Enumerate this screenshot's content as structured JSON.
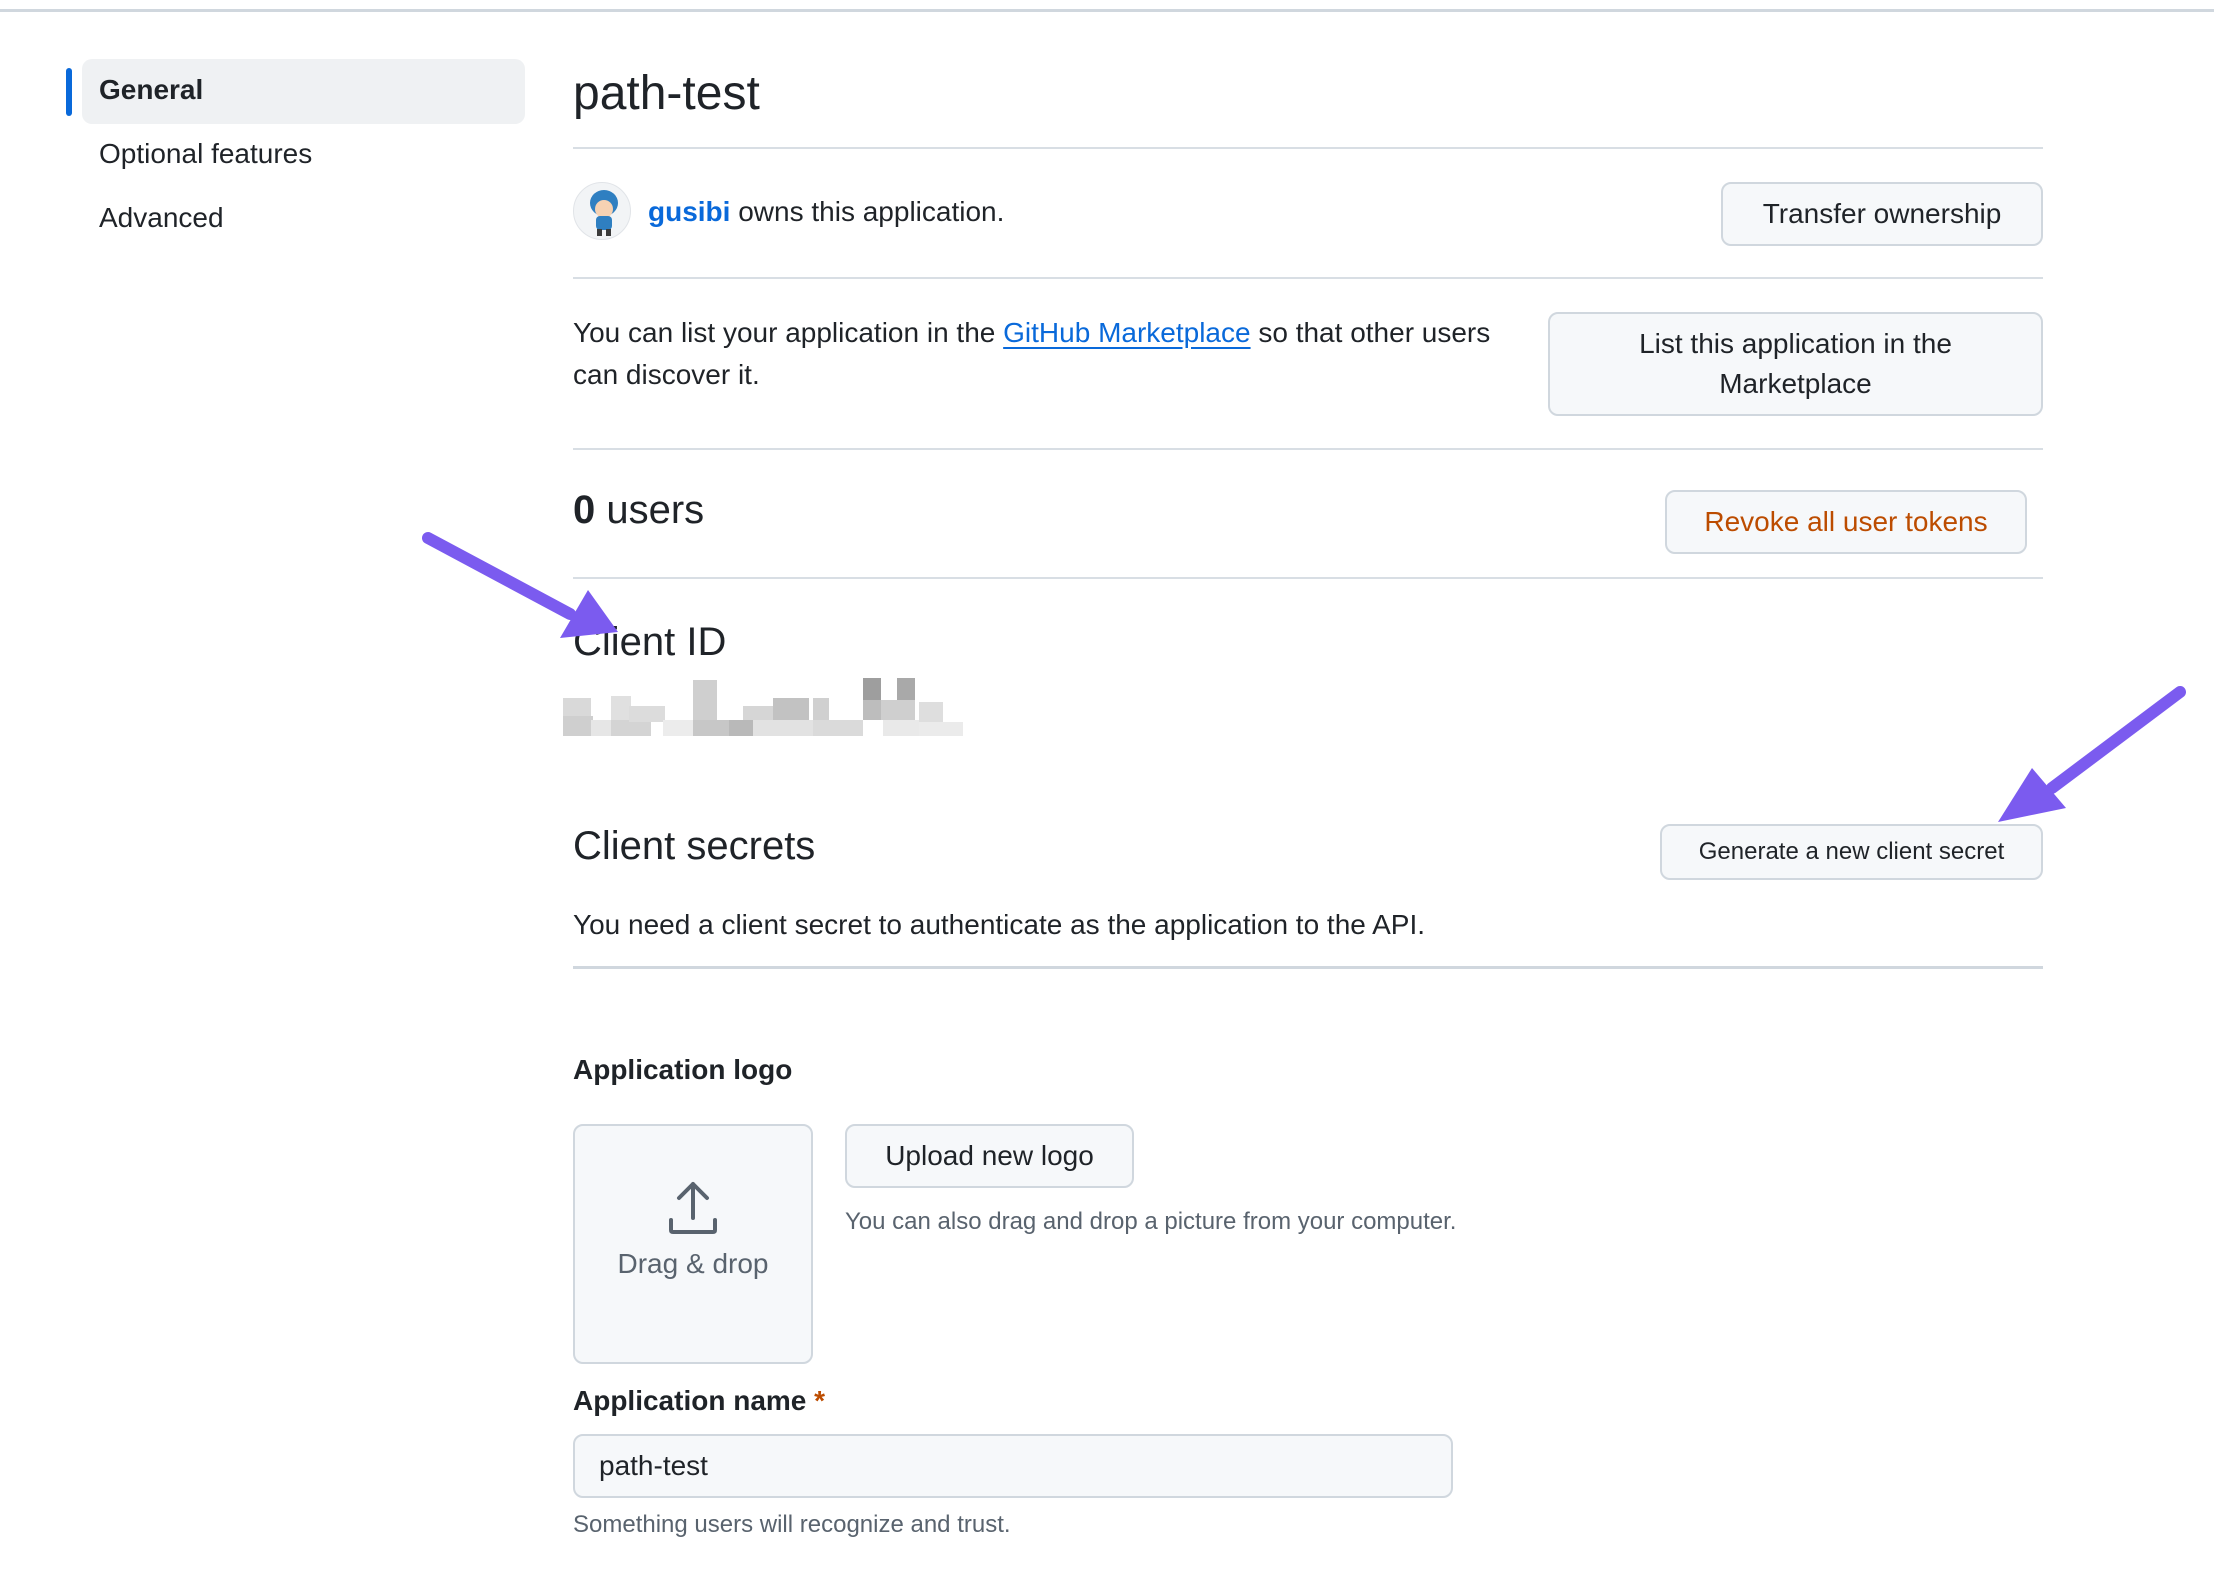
{
  "sidebar": {
    "items": [
      {
        "label": "General",
        "active": true
      },
      {
        "label": "Optional features",
        "active": false
      },
      {
        "label": "Advanced",
        "active": false
      }
    ]
  },
  "app": {
    "title": "path-test",
    "owner_name": "gusibi",
    "owner_suffix": " owns this application.",
    "transfer_button": "Transfer ownership"
  },
  "marketplace": {
    "text_before": "You can list your application in the ",
    "link_text": "GitHub Marketplace",
    "text_after": " so that other users can discover it.",
    "button": "List this application in the Marketplace"
  },
  "users": {
    "count": "0",
    "label": " users",
    "revoke_button": "Revoke all user tokens"
  },
  "client_id": {
    "heading": "Client ID"
  },
  "client_secrets": {
    "heading": "Client secrets",
    "generate_button": "Generate a new client secret",
    "description": "You need a client secret to authenticate as the application to the API."
  },
  "logo": {
    "label": "Application logo",
    "dropzone_text": "Drag & drop",
    "upload_button": "Upload new logo",
    "hint": "You can also drag and drop a picture from your computer."
  },
  "app_name": {
    "label": "Application name",
    "required_marker": "*",
    "value": "path-test",
    "hint": "Something users will recognize and trust."
  },
  "colors": {
    "accent": "#0969da",
    "danger": "#bc4c00",
    "annotation_arrow": "#7b5bef"
  },
  "icons": {
    "upload": "upload-icon",
    "avatar": "avatar-icon"
  }
}
